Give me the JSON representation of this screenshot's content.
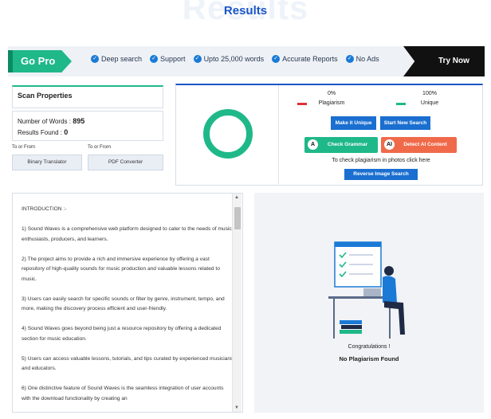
{
  "header": {
    "title": "Results",
    "ghost_title": "Results"
  },
  "banner": {
    "gopro_label": "Go Pro",
    "features": [
      "Deep search",
      "Support",
      "Upto 25,000 words",
      "Accurate Reports",
      "No Ads"
    ],
    "try_now_label": "Try Now"
  },
  "scan": {
    "title": "Scan Properties",
    "words_label": "Number of Words :",
    "words_value": "895",
    "results_label": "Results Found :",
    "results_value": "0"
  },
  "tools": [
    {
      "caption": "To or From",
      "label": "Binary Translator"
    },
    {
      "caption": "To or From",
      "label": "PDF Converter"
    }
  ],
  "result": {
    "plag_pct": "0%",
    "unique_pct": "100%",
    "plag_label": "Plagiarism",
    "unique_label": "Unique",
    "unique_fraction": 1.0,
    "buttons": {
      "make_unique": "Make it Unique",
      "new_search": "Start New Search",
      "check_grammar": "Check Grammar",
      "detect_ai": "Detect AI Content",
      "reverse_image": "Reverse Image Search"
    },
    "icons": {
      "grammar_icon_text": "A",
      "ai_icon_text": "AI"
    },
    "hint": "To check plagiarism in photos click here"
  },
  "text": {
    "paragraphs": [
      "INTRODUCTION :-",
      "1)     Sound Waves is a comprehensive web platform designed to cater to the needs of music enthusiasts, producers, and learners.",
      "2)     The project aims to provide a rich and immersive experience by offering a vast repository of high-quality sounds for music production and valuable lessons related to music.",
      "3)     Users can easily search for specific sounds or filter by genre, instrument, tempo, and more, making the discovery process efficient and user-friendly.",
      "4)     Sound Waves goes beyond being just a resource repository by offering a dedicated section for music education.",
      "5)     Users can access valuable lessons, tutorials, and tips curated by experienced musicians and educators.",
      "6)     One distinctive feature of Sound Waves is the seamless integration of user accounts with the download functionality by creating an"
    ]
  },
  "congrats": {
    "line1": "Congratulations !",
    "line2": "No Plagiarism Found"
  },
  "colors": {
    "accent_green": "#1fb889",
    "accent_blue": "#1a56c6",
    "plag_red": "#e0303a",
    "orange": "#f06a4a"
  }
}
